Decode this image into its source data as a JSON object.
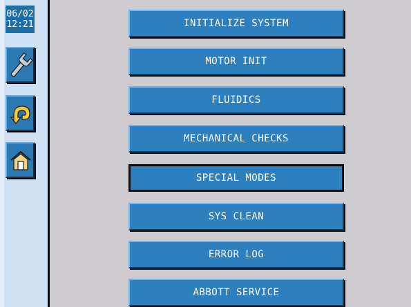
{
  "clock": {
    "date": "06/02",
    "time": "12:21"
  },
  "sidebar": {
    "buttons": [
      {
        "id": "tools",
        "icon": "wrench-icon"
      },
      {
        "id": "back",
        "icon": "undo-arrow-icon"
      },
      {
        "id": "home",
        "icon": "home-icon"
      }
    ]
  },
  "menu": {
    "items": [
      {
        "label": "INITIALIZE SYSTEM"
      },
      {
        "label": "MOTOR INIT"
      },
      {
        "label": "FLUIDICS"
      },
      {
        "label": "MECHANICAL CHECKS"
      },
      {
        "label": "SPECIAL MODES",
        "selected": true
      },
      {
        "label": "SYS CLEAN"
      },
      {
        "label": "ERROR LOG"
      },
      {
        "label": "ABBOTT SERVICE"
      }
    ]
  },
  "colors": {
    "button": "#2e7fbd",
    "sidebar": "#cfe1f3",
    "background": "#cdcbd0",
    "text": "#ffffff"
  }
}
